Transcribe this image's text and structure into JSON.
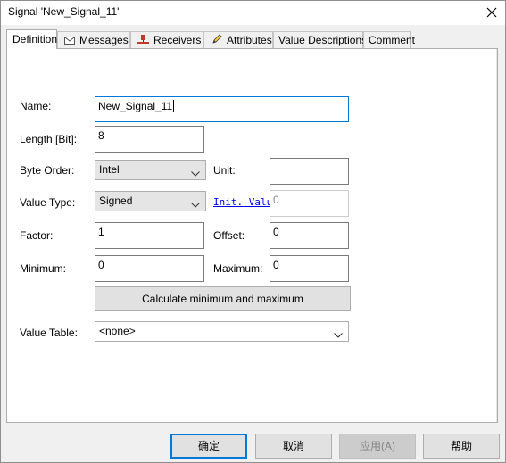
{
  "window": {
    "title": "Signal 'New_Signal_11'"
  },
  "tabs": [
    {
      "label": "Definition",
      "icon": "none",
      "active": true
    },
    {
      "label": "Messages",
      "icon": "envelope-icon"
    },
    {
      "label": "Receivers",
      "icon": "receiver-node-icon"
    },
    {
      "label": "Attributes",
      "icon": "edit-pencil-icon"
    },
    {
      "label": "Value Descriptions",
      "icon": "none"
    },
    {
      "label": "Comment",
      "icon": "none"
    }
  ],
  "form": {
    "name_label": "Name:",
    "name_value": "New_Signal_11",
    "length_label": "Length [Bit]:",
    "length_value": "8",
    "byte_order_label": "Byte Order:",
    "byte_order_value": "Intel",
    "unit_label": "Unit:",
    "unit_value": "",
    "value_type_label": "Value Type:",
    "value_type_value": "Signed",
    "init_value_link": "Init. Value",
    "init_value_value": "0",
    "factor_label": "Factor:",
    "factor_value": "1",
    "offset_label": "Offset:",
    "offset_value": "0",
    "minimum_label": "Minimum:",
    "minimum_value": "0",
    "maximum_label": "Maximum:",
    "maximum_value": "0",
    "calc_button_label": "Calculate minimum and maximum",
    "value_table_label": "Value Table:",
    "value_table_value": "<none>"
  },
  "footer": {
    "ok_label": "确定",
    "cancel_label": "取消",
    "apply_label": "应用(A)",
    "help_label": "帮助"
  },
  "colors": {
    "focus_border": "#0078d7",
    "link": "#0000ee",
    "dialog_bg": "#f0f0f0"
  }
}
